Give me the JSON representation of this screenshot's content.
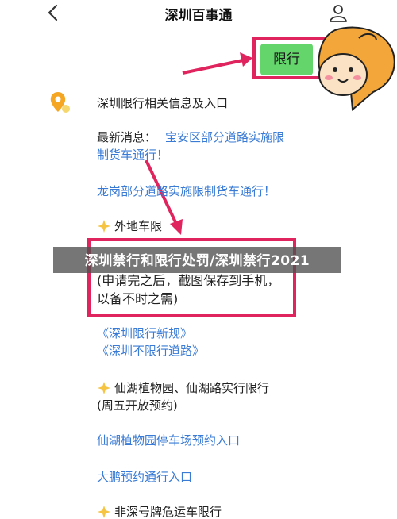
{
  "header": {
    "title": "深圳百事通",
    "back_icon": "chevron-left-icon",
    "user_icon": "user-icon"
  },
  "limit_button": {
    "label": "限行",
    "color": "#63d56b",
    "highlight_color": "#e0245e"
  },
  "content": {
    "info_title": "深圳限行相关信息及入口",
    "news_label": "最新消息：",
    "news_link_line1": "宝安区部分道路实施限",
    "news_link_line2": "制货车通行！",
    "longgang_link": "龙岗部分道路实施限制货车通行！",
    "outside_heading": "外地车限",
    "note_line1": "(申请完之后，截图保存到手机，",
    "note_line2": "以备不时之需)",
    "newrule_link": "《深圳限行新规》",
    "notlimit_link": "《深圳不限行道路》",
    "lake_heading": "仙湖植物园、仙湖路实行限行",
    "lake_sub": "(周五开放预约)",
    "lake_parking_link": "仙湖植物园停车场预约入口",
    "dapeng_link": "大鹏预约通行入口",
    "nonsz_heading": "非深号牌危运车限行"
  },
  "banner": {
    "text": "深圳禁行和限行处罚/深圳禁行2021"
  },
  "colors": {
    "link": "#3a7bd5",
    "arrow": "#e0245e",
    "pin": "#f5a623"
  }
}
